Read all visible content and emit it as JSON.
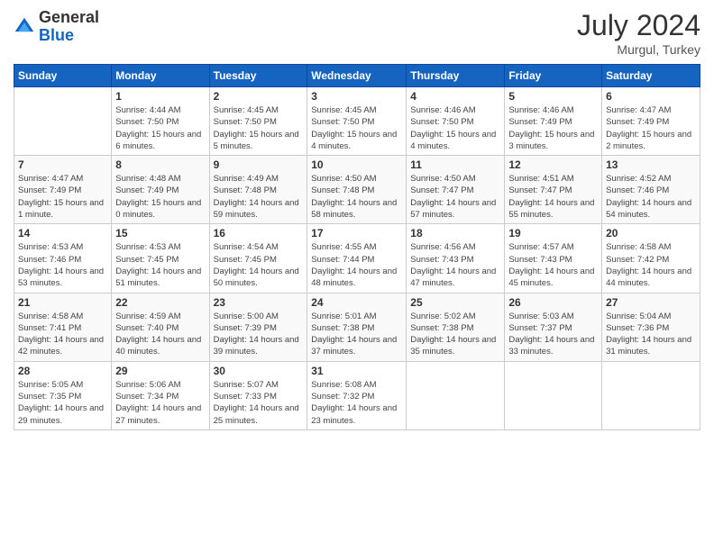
{
  "header": {
    "logo_general": "General",
    "logo_blue": "Blue",
    "month_year": "July 2024",
    "location": "Murgul, Turkey"
  },
  "weekdays": [
    "Sunday",
    "Monday",
    "Tuesday",
    "Wednesday",
    "Thursday",
    "Friday",
    "Saturday"
  ],
  "weeks": [
    [
      {
        "day": "",
        "sunrise": "",
        "sunset": "",
        "daylight": ""
      },
      {
        "day": "1",
        "sunrise": "Sunrise: 4:44 AM",
        "sunset": "Sunset: 7:50 PM",
        "daylight": "Daylight: 15 hours and 6 minutes."
      },
      {
        "day": "2",
        "sunrise": "Sunrise: 4:45 AM",
        "sunset": "Sunset: 7:50 PM",
        "daylight": "Daylight: 15 hours and 5 minutes."
      },
      {
        "day": "3",
        "sunrise": "Sunrise: 4:45 AM",
        "sunset": "Sunset: 7:50 PM",
        "daylight": "Daylight: 15 hours and 4 minutes."
      },
      {
        "day": "4",
        "sunrise": "Sunrise: 4:46 AM",
        "sunset": "Sunset: 7:50 PM",
        "daylight": "Daylight: 15 hours and 4 minutes."
      },
      {
        "day": "5",
        "sunrise": "Sunrise: 4:46 AM",
        "sunset": "Sunset: 7:49 PM",
        "daylight": "Daylight: 15 hours and 3 minutes."
      },
      {
        "day": "6",
        "sunrise": "Sunrise: 4:47 AM",
        "sunset": "Sunset: 7:49 PM",
        "daylight": "Daylight: 15 hours and 2 minutes."
      }
    ],
    [
      {
        "day": "7",
        "sunrise": "Sunrise: 4:47 AM",
        "sunset": "Sunset: 7:49 PM",
        "daylight": "Daylight: 15 hours and 1 minute."
      },
      {
        "day": "8",
        "sunrise": "Sunrise: 4:48 AM",
        "sunset": "Sunset: 7:49 PM",
        "daylight": "Daylight: 15 hours and 0 minutes."
      },
      {
        "day": "9",
        "sunrise": "Sunrise: 4:49 AM",
        "sunset": "Sunset: 7:48 PM",
        "daylight": "Daylight: 14 hours and 59 minutes."
      },
      {
        "day": "10",
        "sunrise": "Sunrise: 4:50 AM",
        "sunset": "Sunset: 7:48 PM",
        "daylight": "Daylight: 14 hours and 58 minutes."
      },
      {
        "day": "11",
        "sunrise": "Sunrise: 4:50 AM",
        "sunset": "Sunset: 7:47 PM",
        "daylight": "Daylight: 14 hours and 57 minutes."
      },
      {
        "day": "12",
        "sunrise": "Sunrise: 4:51 AM",
        "sunset": "Sunset: 7:47 PM",
        "daylight": "Daylight: 14 hours and 55 minutes."
      },
      {
        "day": "13",
        "sunrise": "Sunrise: 4:52 AM",
        "sunset": "Sunset: 7:46 PM",
        "daylight": "Daylight: 14 hours and 54 minutes."
      }
    ],
    [
      {
        "day": "14",
        "sunrise": "Sunrise: 4:53 AM",
        "sunset": "Sunset: 7:46 PM",
        "daylight": "Daylight: 14 hours and 53 minutes."
      },
      {
        "day": "15",
        "sunrise": "Sunrise: 4:53 AM",
        "sunset": "Sunset: 7:45 PM",
        "daylight": "Daylight: 14 hours and 51 minutes."
      },
      {
        "day": "16",
        "sunrise": "Sunrise: 4:54 AM",
        "sunset": "Sunset: 7:45 PM",
        "daylight": "Daylight: 14 hours and 50 minutes."
      },
      {
        "day": "17",
        "sunrise": "Sunrise: 4:55 AM",
        "sunset": "Sunset: 7:44 PM",
        "daylight": "Daylight: 14 hours and 48 minutes."
      },
      {
        "day": "18",
        "sunrise": "Sunrise: 4:56 AM",
        "sunset": "Sunset: 7:43 PM",
        "daylight": "Daylight: 14 hours and 47 minutes."
      },
      {
        "day": "19",
        "sunrise": "Sunrise: 4:57 AM",
        "sunset": "Sunset: 7:43 PM",
        "daylight": "Daylight: 14 hours and 45 minutes."
      },
      {
        "day": "20",
        "sunrise": "Sunrise: 4:58 AM",
        "sunset": "Sunset: 7:42 PM",
        "daylight": "Daylight: 14 hours and 44 minutes."
      }
    ],
    [
      {
        "day": "21",
        "sunrise": "Sunrise: 4:58 AM",
        "sunset": "Sunset: 7:41 PM",
        "daylight": "Daylight: 14 hours and 42 minutes."
      },
      {
        "day": "22",
        "sunrise": "Sunrise: 4:59 AM",
        "sunset": "Sunset: 7:40 PM",
        "daylight": "Daylight: 14 hours and 40 minutes."
      },
      {
        "day": "23",
        "sunrise": "Sunrise: 5:00 AM",
        "sunset": "Sunset: 7:39 PM",
        "daylight": "Daylight: 14 hours and 39 minutes."
      },
      {
        "day": "24",
        "sunrise": "Sunrise: 5:01 AM",
        "sunset": "Sunset: 7:38 PM",
        "daylight": "Daylight: 14 hours and 37 minutes."
      },
      {
        "day": "25",
        "sunrise": "Sunrise: 5:02 AM",
        "sunset": "Sunset: 7:38 PM",
        "daylight": "Daylight: 14 hours and 35 minutes."
      },
      {
        "day": "26",
        "sunrise": "Sunrise: 5:03 AM",
        "sunset": "Sunset: 7:37 PM",
        "daylight": "Daylight: 14 hours and 33 minutes."
      },
      {
        "day": "27",
        "sunrise": "Sunrise: 5:04 AM",
        "sunset": "Sunset: 7:36 PM",
        "daylight": "Daylight: 14 hours and 31 minutes."
      }
    ],
    [
      {
        "day": "28",
        "sunrise": "Sunrise: 5:05 AM",
        "sunset": "Sunset: 7:35 PM",
        "daylight": "Daylight: 14 hours and 29 minutes."
      },
      {
        "day": "29",
        "sunrise": "Sunrise: 5:06 AM",
        "sunset": "Sunset: 7:34 PM",
        "daylight": "Daylight: 14 hours and 27 minutes."
      },
      {
        "day": "30",
        "sunrise": "Sunrise: 5:07 AM",
        "sunset": "Sunset: 7:33 PM",
        "daylight": "Daylight: 14 hours and 25 minutes."
      },
      {
        "day": "31",
        "sunrise": "Sunrise: 5:08 AM",
        "sunset": "Sunset: 7:32 PM",
        "daylight": "Daylight: 14 hours and 23 minutes."
      },
      {
        "day": "",
        "sunrise": "",
        "sunset": "",
        "daylight": ""
      },
      {
        "day": "",
        "sunrise": "",
        "sunset": "",
        "daylight": ""
      },
      {
        "day": "",
        "sunrise": "",
        "sunset": "",
        "daylight": ""
      }
    ]
  ]
}
